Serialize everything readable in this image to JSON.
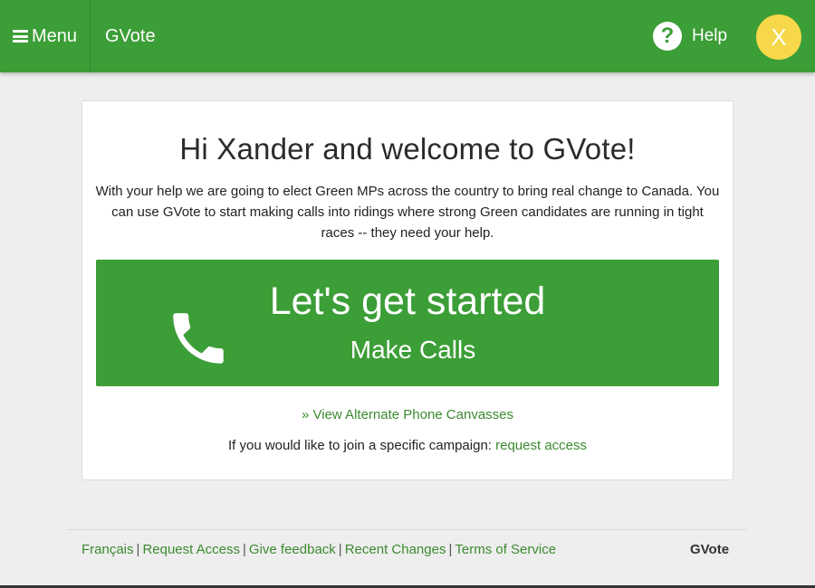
{
  "header": {
    "menu_label": "Menu",
    "brand": "GVote",
    "help_symbol": "?",
    "help_label": "Help",
    "avatar_initial": "X",
    "bar_color": "#3c9e37",
    "avatar_color": "#f6d84a"
  },
  "card": {
    "title": "Hi Xander and welcome to GVote!",
    "intro": "With your help we are going to elect Green MPs across the country to bring real change to Canada. You can use GVote to start making calls into ridings where strong Green candidates are running in tight races -- they need your help.",
    "cta": {
      "icon": "phone-icon",
      "title": "Let's get started",
      "subtitle": "Make Calls"
    },
    "alternate_link": "» View Alternate Phone Canvasses",
    "join_text": "If you would like to join a specific campaign: ",
    "join_link": "request access"
  },
  "footer": {
    "links": [
      "Français",
      "Request Access",
      "Give feedback",
      "Recent Changes",
      "Terms of Service"
    ],
    "separator": "|",
    "brand": "GVote"
  }
}
